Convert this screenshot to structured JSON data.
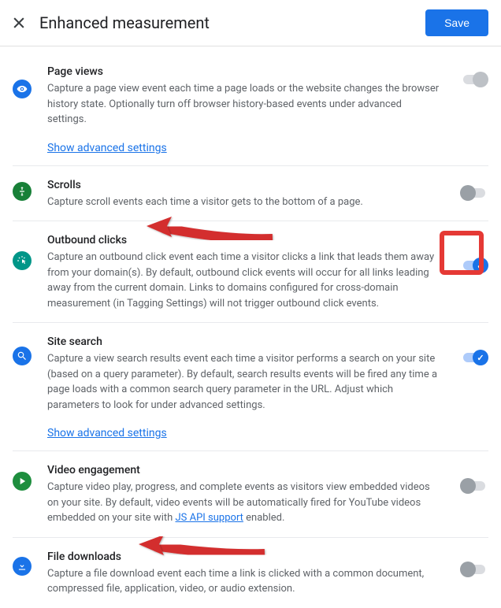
{
  "header": {
    "title": "Enhanced measurement",
    "save_label": "Save"
  },
  "advanced_link": "Show advanced settings",
  "js_api_link": "JS API support",
  "sections": {
    "page_views": {
      "title": "Page views",
      "desc": "Capture a page view event each time a page loads or the website changes the browser history state. Optionally turn off browser history-based events under advanced settings."
    },
    "scrolls": {
      "title": "Scrolls",
      "desc": "Capture scroll events each time a visitor gets to the bottom of a page."
    },
    "outbound": {
      "title": "Outbound clicks",
      "desc": "Capture an outbound click event each time a visitor clicks a link that leads them away from your domain(s). By default, outbound click events will occur for all links leading away from the current domain. Links to domains configured for cross-domain measurement (in Tagging Settings) will not trigger outbound click events."
    },
    "site_search": {
      "title": "Site search",
      "desc": "Capture a view search results event each time a visitor performs a search on your site (based on a query parameter). By default, search results events will be fired any time a page loads with a common search query parameter in the URL. Adjust which parameters to look for under advanced settings."
    },
    "video": {
      "title": "Video engagement",
      "desc_pre": "Capture video play, progress, and complete events as visitors view embedded videos on your site. By default, video events will be automatically fired for YouTube videos embedded on your site with ",
      "desc_post": " enabled."
    },
    "file_downloads": {
      "title": "File downloads",
      "desc": "Capture a file download event each time a link is clicked with a common document, compressed file, application, video, or audio extension."
    }
  }
}
